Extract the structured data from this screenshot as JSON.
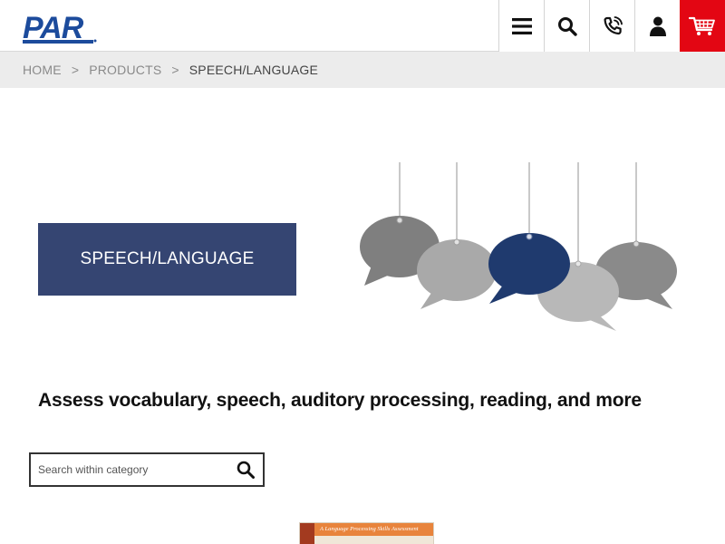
{
  "header": {
    "logo_text": "PAR",
    "icons": [
      "menu-icon",
      "search-icon",
      "phone-icon",
      "user-icon",
      "cart-icon"
    ],
    "cart_color": "#e30613"
  },
  "breadcrumb": {
    "items": [
      "HOME",
      "PRODUCTS"
    ],
    "separator": ">",
    "current": "SPEECH/LANGUAGE"
  },
  "hero": {
    "title": "SPEECH/LANGUAGE",
    "box_color": "#354572"
  },
  "tagline": "Assess vocabulary, speech, auditory processing, reading, and more",
  "search": {
    "placeholder": "Search within category"
  },
  "product": {
    "cover_text": "A Language Processing Skills Assessment"
  },
  "colors": {
    "brand_blue": "#1c4b9c",
    "bubble_navy": "#1f3a6e",
    "bubble_grays": [
      "#7f7f7f",
      "#a9a9a9",
      "#b8b8b8",
      "#8a8a8a"
    ]
  }
}
